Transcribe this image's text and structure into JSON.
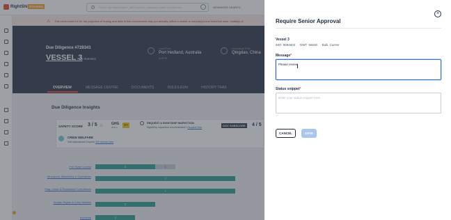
{
  "app": {
    "name": "RightShip",
    "environment_badge": "STAGING"
  },
  "topbar": {
    "search_placeholder": "Search by vessel name, IMO number, Company name or reference",
    "advanced_search": "ADVANCED SEARCH"
  },
  "banner": {
    "text": "This environment is for the purposes of testing and data in this environment may not actually reflect a vessel or company's true historical data. Usability of"
  },
  "vessel": {
    "due_diligence": "Due Diligence #728341",
    "name": "VESSEL 3",
    "imo": "IMO 9594602",
    "load_port_label": "Load Port",
    "load_port": "Port Hedland, Australia",
    "load_port_code": "AUPHE",
    "discharge_port_label": "Discharge Port",
    "discharge_port": "Qingdao, China",
    "discharge_port_code": ""
  },
  "tabs": [
    "OVERVIEW",
    "MESSAGE CENTRE",
    "DOCUMENTS",
    "RULES RUN",
    "HISTORY TRAIL"
  ],
  "insights": {
    "title": "Due Diligence Insights",
    "safety_label": "SAFETY SCORE",
    "safety_score": "3 / 5",
    "ghg_label": "GHG",
    "ghg_sub": "Rating",
    "ghg_rating": "C+",
    "inspection_title": "REQUEST A RIGHTSHIP INSPECTION",
    "inspection_sub": "RightShip inspection recommended?",
    "inspection_link": "Request Now",
    "doc_label": "DOC SUBSCORE",
    "doc_score": "4 / 5",
    "crew_title": "CREW WELFARE",
    "crew_sub": "Self-Assessment Expired",
    "crew_link": "Self Assess Now"
  },
  "chart_data": {
    "type": "bar",
    "categories": [
      "Port State Control",
      "Structures, Machinery & Operations",
      "Flag, Class & Regulatory Compliance",
      "Human Rights & Crew Welfare",
      "Incidents"
    ],
    "series": [
      {
        "values": [
          3,
          7,
          7,
          3,
          2
        ]
      },
      {
        "values": [
          1,
          0,
          0,
          0,
          0
        ]
      }
    ]
  },
  "modal": {
    "title": "Require Senior Approval",
    "vessel_name": "Vessel 3",
    "vessel_imo": "IMO 9594602",
    "vessel_dwt": "DWT 56530",
    "vessel_type": "Bulk Carrier",
    "message_label": "Message",
    "message_value": "Please review",
    "status_label": "Status snippet",
    "status_placeholder": "Enter your status snippet here",
    "cancel_label": "CANCEL",
    "save_label": "SAVE",
    "colors": {
      "primary": "#2f6fd6",
      "save_disabled": "#a9c6f0",
      "brand": "#e7442f"
    }
  }
}
